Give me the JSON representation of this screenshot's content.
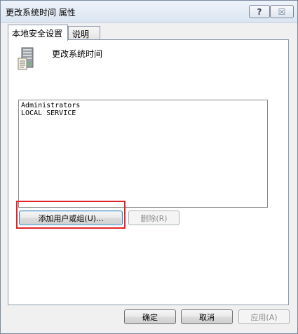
{
  "window": {
    "title": "更改系统时间 属性",
    "help_label": "?",
    "close_label": "☒"
  },
  "tabs": [
    {
      "label": "本地安全设置",
      "active": true
    },
    {
      "label": "说明",
      "active": false
    }
  ],
  "policy": {
    "icon": "server-policy-icon",
    "name": "更改系统时间"
  },
  "accounts": [
    "Administrators",
    "LOCAL SERVICE"
  ],
  "buttons": {
    "add": "添加用户或组(U)...",
    "remove": "删除(R)",
    "ok": "确定",
    "cancel": "取消",
    "apply": "应用(A)"
  },
  "colors": {
    "highlight": "#e0252a"
  }
}
